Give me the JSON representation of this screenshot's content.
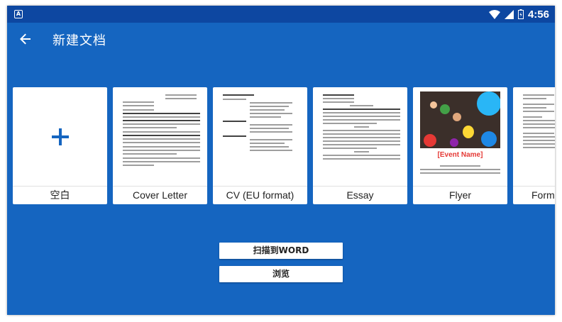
{
  "status_bar": {
    "app_icon": "A",
    "time": "4:56",
    "icons": [
      "wifi-icon",
      "cell-signal-icon",
      "battery-charging-icon"
    ]
  },
  "app_bar": {
    "title": "新建文档",
    "back_icon": "arrow-left-icon"
  },
  "templates": [
    {
      "label": "空白",
      "type": "blank"
    },
    {
      "label": "Cover Letter",
      "type": "doc"
    },
    {
      "label": "CV (EU format)",
      "type": "doc"
    },
    {
      "label": "Essay",
      "type": "doc"
    },
    {
      "label": "Flyer",
      "type": "flyer",
      "event_name": "[Event Name]"
    },
    {
      "label": "Format",
      "type": "doc"
    }
  ],
  "actions": {
    "scan_label": "扫描到WORD",
    "browse_label": "浏览"
  },
  "colors": {
    "background": "#1565c0",
    "status_bar": "#0d47a1",
    "card": "#ffffff"
  }
}
